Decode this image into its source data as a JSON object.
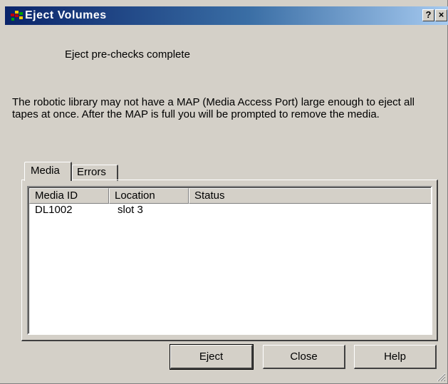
{
  "window": {
    "title": "Eject Volumes",
    "help_glyph": "?",
    "close_glyph": "×"
  },
  "status_text": "Eject pre-checks complete",
  "info_text": "The robotic library may not have a MAP (Media Access Port) large enough to eject all tapes at once.  After the MAP is full you will be prompted to remove the media.",
  "tabs": [
    {
      "label": "Media",
      "selected": true
    },
    {
      "label": "Errors",
      "selected": false
    }
  ],
  "list": {
    "columns": [
      "Media ID",
      "Location",
      "Status"
    ],
    "rows": [
      {
        "media_id": "DL1002",
        "location": "slot 3",
        "status": ""
      }
    ]
  },
  "buttons": {
    "eject": "Eject",
    "close": "Close",
    "help": "Help"
  },
  "colors": {
    "titlebar_start": "#0a246a",
    "titlebar_end": "#a6caf0",
    "face": "#d4d0c8"
  }
}
